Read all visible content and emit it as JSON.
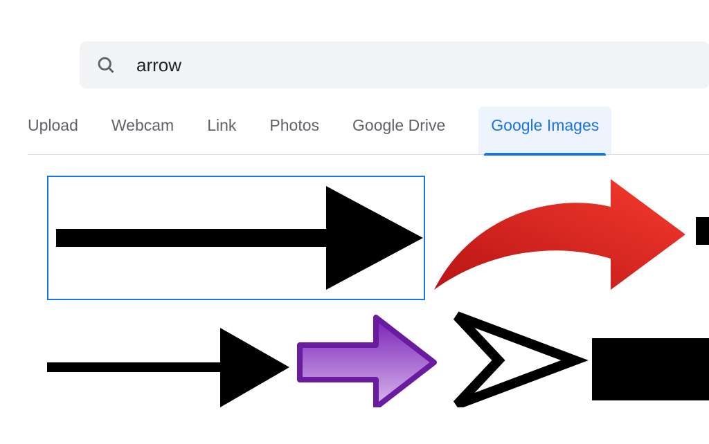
{
  "search": {
    "query": "arrow",
    "placeholder": ""
  },
  "tabs": [
    {
      "label": "Upload",
      "active": false
    },
    {
      "label": "Webcam",
      "active": false
    },
    {
      "label": "Link",
      "active": false
    },
    {
      "label": "Photos",
      "active": false
    },
    {
      "label": "Google Drive",
      "active": false
    },
    {
      "label": "Google Images",
      "active": true
    }
  ],
  "results": [
    {
      "name": "straight-black-arrow",
      "selected": true
    },
    {
      "name": "red-curved-arrow",
      "selected": false
    },
    {
      "name": "black-block-fragment",
      "selected": false
    },
    {
      "name": "thin-black-arrow",
      "selected": false
    },
    {
      "name": "purple-arrow",
      "selected": false
    },
    {
      "name": "outline-arrowhead",
      "selected": false
    },
    {
      "name": "black-rectangle",
      "selected": false
    }
  ]
}
